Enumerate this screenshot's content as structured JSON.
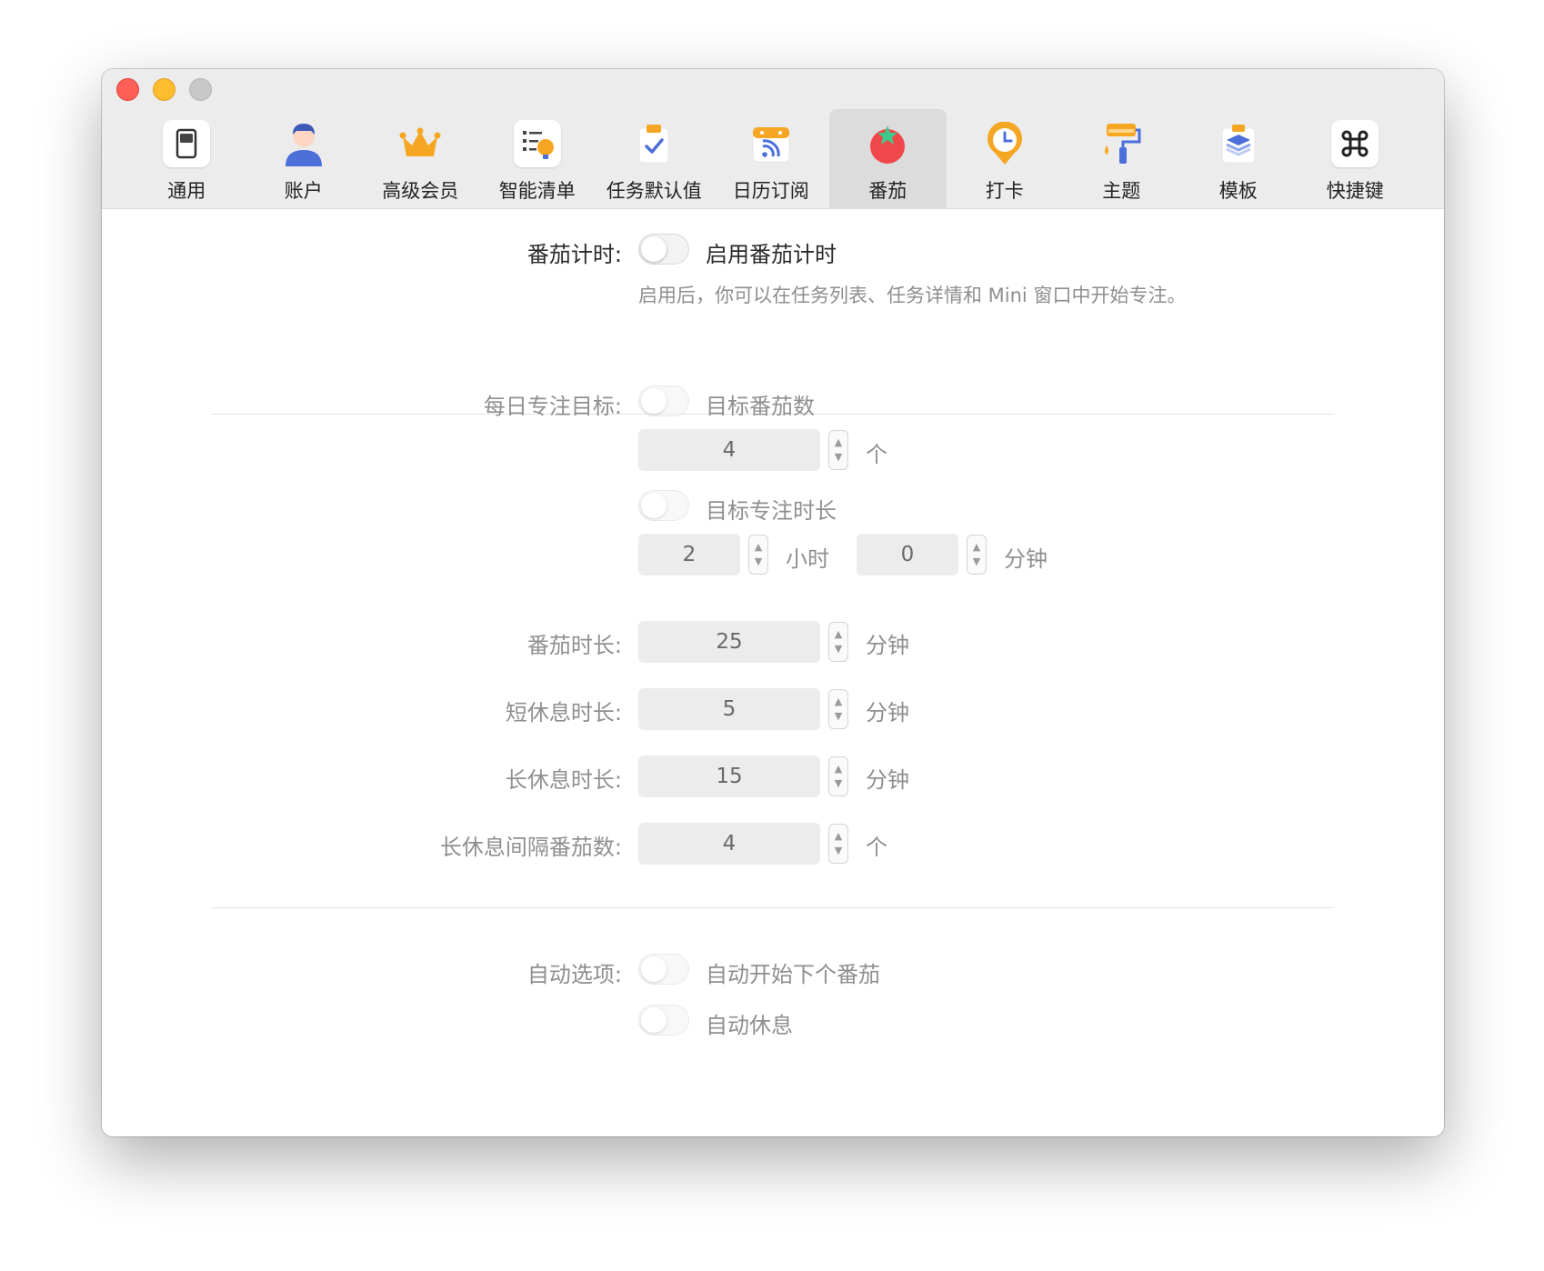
{
  "tabs": [
    {
      "label": "通用",
      "icon": "switch-icon"
    },
    {
      "label": "账户",
      "icon": "user-icon"
    },
    {
      "label": "高级会员",
      "icon": "crown-icon"
    },
    {
      "label": "智能清单",
      "icon": "smart-list-icon"
    },
    {
      "label": "任务默认值",
      "icon": "clipboard-check-icon"
    },
    {
      "label": "日历订阅",
      "icon": "calendar-rss-icon"
    },
    {
      "label": "番茄",
      "icon": "tomato-icon"
    },
    {
      "label": "打卡",
      "icon": "clock-pin-icon"
    },
    {
      "label": "主题",
      "icon": "paint-roller-icon"
    },
    {
      "label": "模板",
      "icon": "layers-icon"
    },
    {
      "label": "快捷键",
      "icon": "command-icon"
    }
  ],
  "active_tab": "番茄",
  "pomo": {
    "label": "番茄计时:",
    "toggle_text": "启用番茄计时",
    "hint": "启用后，你可以在任务列表、任务详情和 Mini 窗口中开始专注。"
  },
  "daily_goal": {
    "label": "每日专注目标:",
    "count_toggle_text": "目标番茄数",
    "count_value": "4",
    "count_unit": "个",
    "duration_toggle_text": "目标专注时长",
    "hours_value": "2",
    "hours_unit": "小时",
    "minutes_value": "0",
    "minutes_unit": "分钟"
  },
  "durations": [
    {
      "label": "番茄时长:",
      "value": "25",
      "unit": "分钟"
    },
    {
      "label": "短休息时长:",
      "value": "5",
      "unit": "分钟"
    },
    {
      "label": "长休息时长:",
      "value": "15",
      "unit": "分钟"
    },
    {
      "label": "长休息间隔番茄数:",
      "value": "4",
      "unit": "个"
    }
  ],
  "auto": {
    "label": "自动选项:",
    "next_pomo_text": "自动开始下个番茄",
    "auto_break_text": "自动休息"
  },
  "colors": {
    "close": "#fe5f57",
    "minimize": "#febc2e",
    "zoom": "#c8c8c8",
    "accent_orange": "#f5a623",
    "accent_blue": "#4d6fd9",
    "tomato_red": "#f0474a"
  }
}
